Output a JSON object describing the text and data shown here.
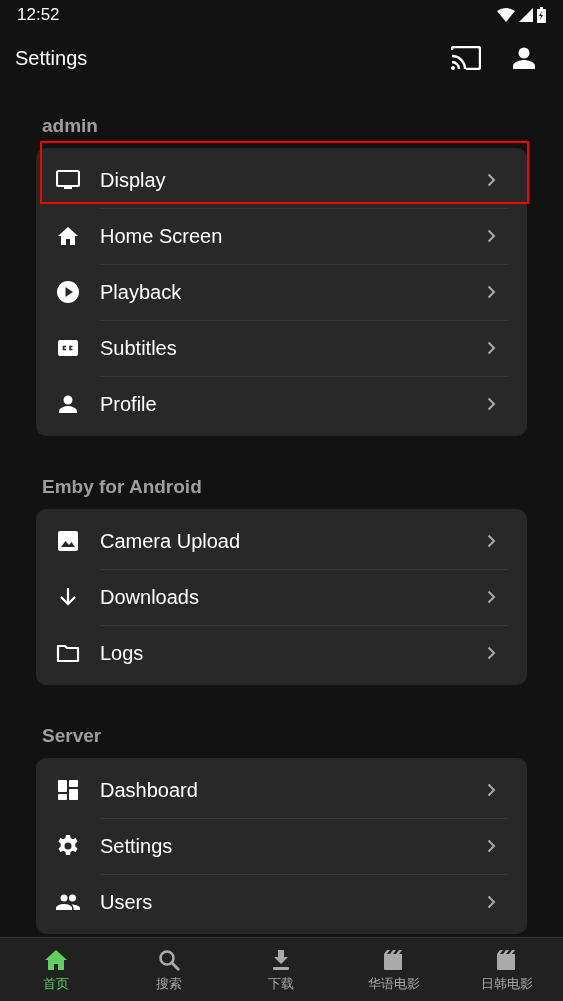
{
  "status_bar": {
    "time": "12:52"
  },
  "app_bar": {
    "title": "Settings"
  },
  "sections": [
    {
      "title": "admin",
      "items": [
        {
          "label": "Display",
          "highlighted": true
        },
        {
          "label": "Home Screen",
          "highlighted": false
        },
        {
          "label": "Playback",
          "highlighted": false
        },
        {
          "label": "Subtitles",
          "highlighted": false
        },
        {
          "label": "Profile",
          "highlighted": false
        }
      ]
    },
    {
      "title": "Emby for Android",
      "items": [
        {
          "label": "Camera Upload",
          "highlighted": false
        },
        {
          "label": "Downloads",
          "highlighted": false
        },
        {
          "label": "Logs",
          "highlighted": false
        }
      ]
    },
    {
      "title": "Server",
      "items": [
        {
          "label": "Dashboard",
          "highlighted": false
        },
        {
          "label": "Settings",
          "highlighted": false
        },
        {
          "label": "Users",
          "highlighted": false
        }
      ]
    }
  ],
  "bottom_nav": [
    {
      "label": "首页",
      "selected": true
    },
    {
      "label": "搜索",
      "selected": false
    },
    {
      "label": "下载",
      "selected": false
    },
    {
      "label": "华语电影",
      "selected": false
    },
    {
      "label": "日韩电影",
      "selected": false
    }
  ]
}
